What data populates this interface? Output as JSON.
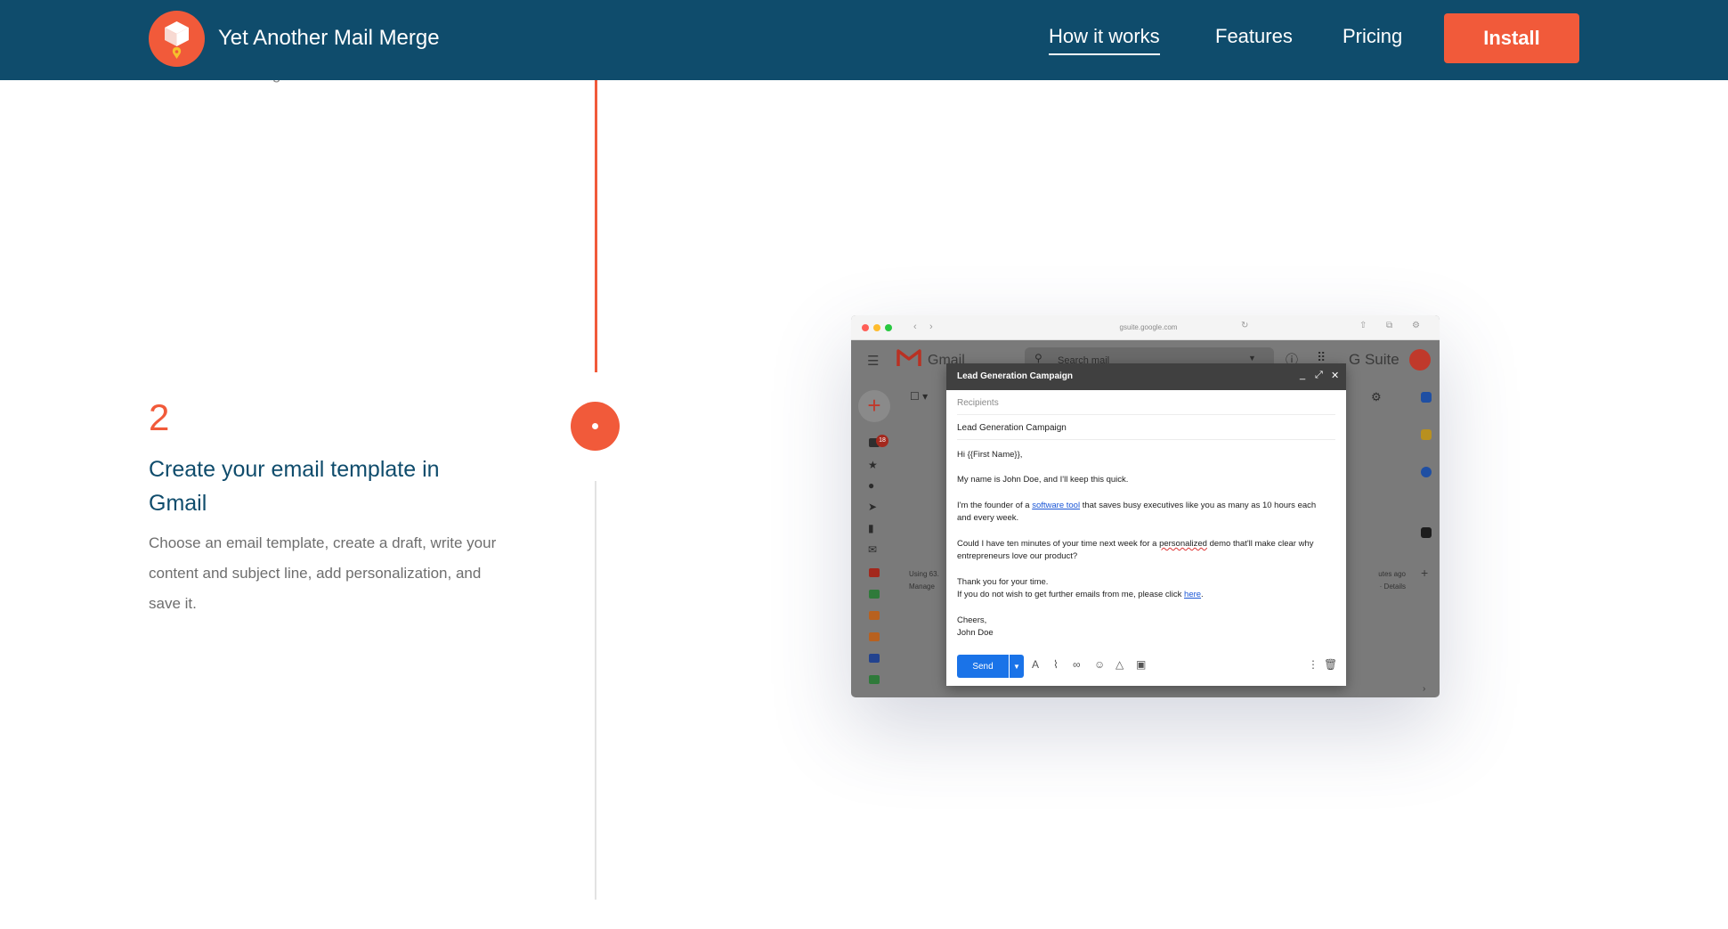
{
  "header": {
    "brand": "Yet Another Mail Merge",
    "nav": [
      {
        "label": "How it works"
      },
      {
        "label": "Features"
      },
      {
        "label": "Pricing"
      }
    ],
    "install_label": "Install",
    "colors": {
      "navbar": "#0f4c6c",
      "accent": "#f15a3a"
    }
  },
  "previous_step": {
    "clipped_text": "contacts from Google Contacts."
  },
  "step": {
    "number": "2",
    "title": "Create your email template in Gmail",
    "description": "Choose an email template, create a draft, write your content and subject line, add personalization, and save it."
  },
  "screenshot": {
    "browser_url": "gsuite.google.com",
    "gmail": {
      "product_name": "Gmail",
      "search_placeholder": "Search mail",
      "suite_label": "G Suite",
      "inbox_badge": "18",
      "storage": [
        "Using 63.",
        "Manage"
      ],
      "activity": [
        "utes ago",
        "· Details"
      ]
    },
    "compose": {
      "window_title": "Lead Generation Campaign",
      "recipients_placeholder": "Recipients",
      "subject": "Lead Generation Campaign",
      "greeting": "Hi {{First Name}},",
      "intro": "My name is John Doe, and I'll keep this quick.",
      "founder_before": "I'm the founder of a ",
      "founder_link": "software tool",
      "founder_after": " that saves busy executives like you as many as 10 hours each",
      "founder_line2": "and every week.",
      "ask_before": "Could I have ten minutes of your time next week for a ",
      "ask_spell": "personalized",
      "ask_after": " demo that'll make clear why",
      "ask_line2": "entrepreneurs love our product?",
      "thanks": "Thank you for your time.",
      "unsub_before": "If you do not wish to get further emails from me, please click ",
      "unsub_link": "here",
      "unsub_after": ".",
      "signoff": "Cheers,",
      "signature": "John Doe",
      "send_label": "Send"
    }
  }
}
